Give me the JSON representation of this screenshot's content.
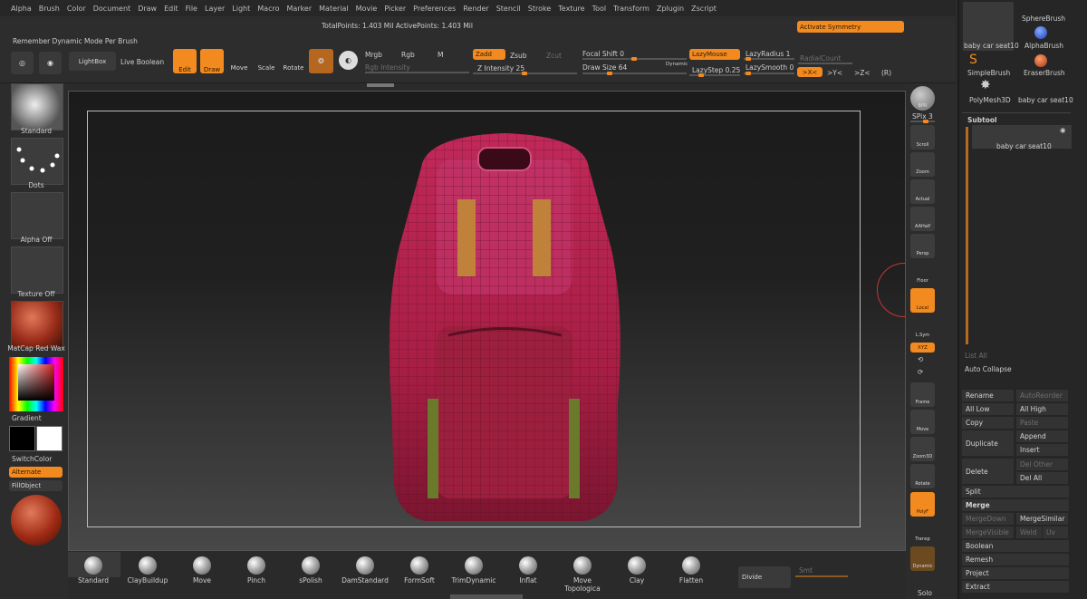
{
  "menubar": [
    "Alpha",
    "Brush",
    "Color",
    "Document",
    "Draw",
    "Edit",
    "File",
    "Layer",
    "Light",
    "Macro",
    "Marker",
    "Material",
    "Movie",
    "Picker",
    "Preferences",
    "Render",
    "Stencil",
    "Stroke",
    "Texture",
    "Tool",
    "Transform",
    "Zplugin",
    "Zscript"
  ],
  "status": {
    "total_points": "TotalPoints: 1.403 Mil ActivePoints: 1.403 Mil"
  },
  "top": {
    "remember": "Remember Dynamic Mode Per Brush",
    "activate_symmetry": "Activate Symmetry",
    "lightbox": "LightBox",
    "live_boolean": "Live Boolean",
    "edit": "Edit",
    "draw": "Draw",
    "move": "Move",
    "scale": "Scale",
    "rotate": "Rotate",
    "mrgb": "Mrgb",
    "rgb": "Rgb",
    "m": "M",
    "rgb_intensity": "Rgb Intensity",
    "zadd": "Zadd",
    "zsub": "Zsub",
    "zcut": "Zcut",
    "z_intensity": "Z Intensity 25",
    "focal_shift": "Focal Shift 0",
    "draw_size": "Draw Size 64",
    "dynamic": "Dynamic",
    "lazymouse": "LazyMouse",
    "lazystep": "LazyStep 0.25",
    "lazyradius": "LazyRadius 1",
    "lazysmooth": "LazySmooth 0",
    "radialcount": "RadialCount",
    "sym_x": ">X<",
    "sym_y": ">Y<",
    "sym_z": ">Z<",
    "sym_r": "(R)"
  },
  "left": {
    "standard": "Standard",
    "dots": "Dots",
    "alpha_off": "Alpha Off",
    "texture_off": "Texture Off",
    "matcap": "MatCap Red Wax",
    "gradient": "Gradient",
    "switchcolor": "SwitchColor",
    "alternate": "Alternate",
    "fillobject": "FillObject"
  },
  "right_shelf": [
    "BPR",
    "SPix 3",
    "Scroll",
    "Zoom",
    "Actual",
    "AAHalf",
    "Persp",
    "Floor",
    "Local",
    "L.Sym",
    "XYZ",
    "Frame",
    "Move",
    "Zoom3D",
    "Rotate",
    "PolyF",
    "Transp",
    "Dynamic",
    "Solo"
  ],
  "tools": {
    "items": [
      "baby car seat10",
      "SphereBrush",
      "AlphaBrush",
      "SimpleBrush",
      "EraserBrush",
      "PolyMesh3D",
      "baby car seat10"
    ],
    "subtool_header": "Subtool",
    "subtool_name": "baby car seat10"
  },
  "subtool_ops": {
    "list_all": "List All",
    "auto_collapse": "Auto Collapse",
    "rename": "Rename",
    "autoreorder": "AutoReorder",
    "all_low": "All Low",
    "all_high": "All High",
    "copy": "Copy",
    "paste": "Paste",
    "duplicate": "Duplicate",
    "append": "Append",
    "insert": "Insert",
    "delete": "Delete",
    "del_other": "Del Other",
    "del_all": "Del All",
    "split": "Split",
    "merge": "Merge",
    "mergedown": "MergeDown",
    "mergesimilar": "MergeSimilar",
    "mergevisible": "MergeVisible",
    "weld": "Weld",
    "uv": "Uv",
    "boolean": "Boolean",
    "remesh": "Remesh",
    "project": "Project",
    "extract": "Extract"
  },
  "bottom_brushes": [
    "Standard",
    "ClayBuildup",
    "Move",
    "Pinch",
    "sPolish",
    "DamStandard",
    "FormSoft",
    "TrimDynamic",
    "Inflat",
    "Move Topologica",
    "Clay",
    "Flatten"
  ],
  "divide": "Divide",
  "smt": "Smt",
  "colors": {
    "accent": "#f28a1f",
    "seat": "#b0234b"
  }
}
